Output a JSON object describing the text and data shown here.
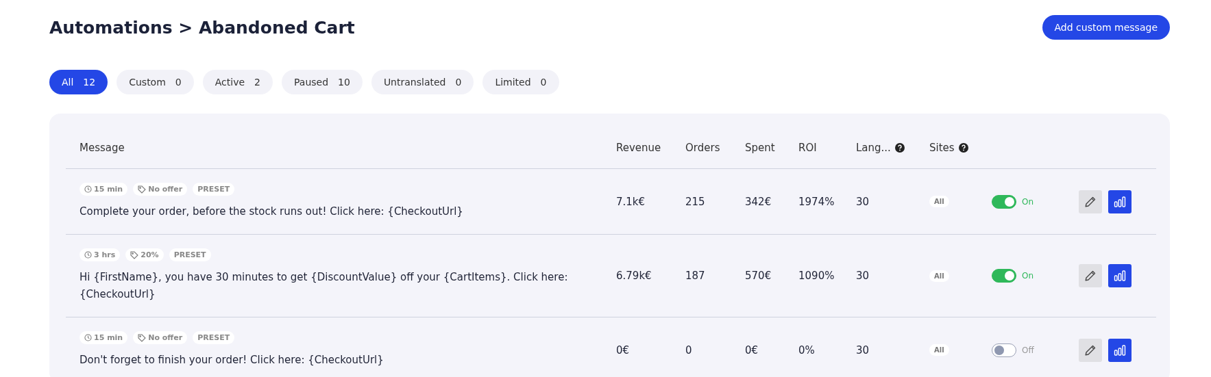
{
  "title": "Automations > Abandoned Cart",
  "add_button": "Add custom message",
  "filters": [
    {
      "label": "All",
      "count": "12",
      "selected": true
    },
    {
      "label": "Custom",
      "count": "0",
      "selected": false
    },
    {
      "label": "Active",
      "count": "2",
      "selected": false
    },
    {
      "label": "Paused",
      "count": "10",
      "selected": false
    },
    {
      "label": "Untranslated",
      "count": "0",
      "selected": false
    },
    {
      "label": "Limited",
      "count": "0",
      "selected": false
    }
  ],
  "table": {
    "columns": [
      {
        "label": "Message",
        "help": false
      },
      {
        "label": "Revenue",
        "help": false
      },
      {
        "label": "Orders",
        "help": false
      },
      {
        "label": "Spent",
        "help": false
      },
      {
        "label": "ROI",
        "help": false
      },
      {
        "label": "Lang...",
        "help": true
      },
      {
        "label": "Sites",
        "help": true
      }
    ],
    "rows": [
      {
        "delay": "15 min",
        "offer": "No offer",
        "tag": "PRESET",
        "message": "Complete your order, before the stock runs out! Click here: {CheckoutUrl}",
        "revenue": "7.1k€",
        "orders": "215",
        "spent": "342€",
        "roi": "1974%",
        "languages": "30",
        "sites": "All",
        "on": true,
        "status": "On"
      },
      {
        "delay": "3 hrs",
        "offer": "20%",
        "tag": "PRESET",
        "message": "Hi {FirstName}, you have 30 minutes to get {DiscountValue} off your {CartItems}. Click here: {CheckoutUrl}",
        "revenue": "6.79k€",
        "orders": "187",
        "spent": "570€",
        "roi": "1090%",
        "languages": "30",
        "sites": "All",
        "on": true,
        "status": "On"
      },
      {
        "delay": "15 min",
        "offer": "No offer",
        "tag": "PRESET",
        "message": "Don't forget to finish your order! Click here: {CheckoutUrl}",
        "revenue": "0€",
        "orders": "0",
        "spent": "0€",
        "roi": "0%",
        "languages": "30",
        "sites": "All",
        "on": false,
        "status": "Off"
      }
    ]
  }
}
